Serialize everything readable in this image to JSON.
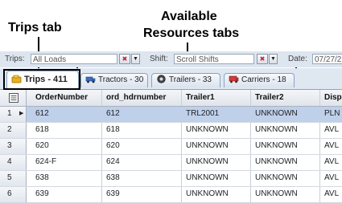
{
  "annotations": {
    "trips_tab": "Trips tab",
    "resources_line1": "Available",
    "resources_line2": "Resources tabs"
  },
  "filterbar": {
    "trips_label": "Trips:",
    "trips_value": "All Loads",
    "shift_label": "Shift:",
    "shift_value": "Scroll Shifts",
    "date_label": "Date:",
    "date_value": "07/27/2"
  },
  "tabs": [
    {
      "label": "Trips - 411",
      "icon": "trips-icon",
      "active": true
    },
    {
      "label": "Tractors - 30",
      "icon": "tractor-icon",
      "active": false
    },
    {
      "label": "Trailers - 33",
      "icon": "trailer-icon",
      "active": false
    },
    {
      "label": "Carriers - 18",
      "icon": "carrier-icon",
      "active": false
    }
  ],
  "grid": {
    "columns": [
      "OrderNumber",
      "ord_hdrnumber",
      "Trailer1",
      "Trailer2",
      "Disp"
    ],
    "rows": [
      {
        "num": "1",
        "cells": [
          "612",
          "612",
          "TRL2001",
          "UNKNOWN",
          "PLN"
        ],
        "selected": true
      },
      {
        "num": "2",
        "cells": [
          "618",
          "618",
          "UNKNOWN",
          "UNKNOWN",
          "AVL"
        ],
        "selected": false
      },
      {
        "num": "3",
        "cells": [
          "620",
          "620",
          "UNKNOWN",
          "UNKNOWN",
          "AVL"
        ],
        "selected": false
      },
      {
        "num": "4",
        "cells": [
          "624-F",
          "624",
          "UNKNOWN",
          "UNKNOWN",
          "AVL"
        ],
        "selected": false
      },
      {
        "num": "5",
        "cells": [
          "638",
          "638",
          "UNKNOWN",
          "UNKNOWN",
          "AVL"
        ],
        "selected": false
      },
      {
        "num": "6",
        "cells": [
          "639",
          "639",
          "UNKNOWN",
          "UNKNOWN",
          "AVL"
        ],
        "selected": false
      }
    ]
  },
  "colors": {
    "selected_row": "#bfd0ea",
    "header_bg": "#dfe7f1"
  }
}
